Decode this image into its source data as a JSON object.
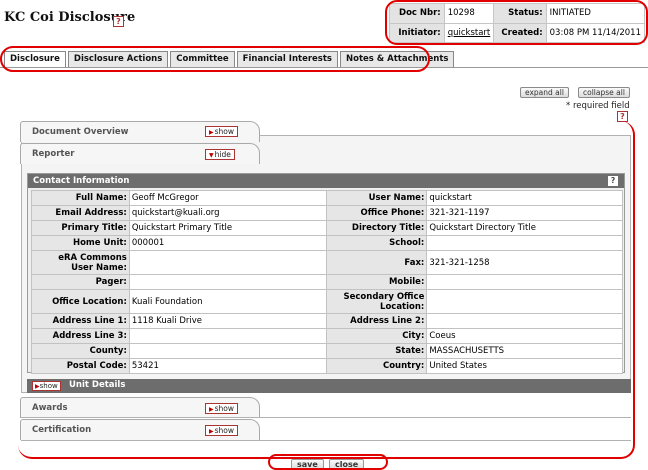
{
  "app": {
    "title": "KC Coi Disclosure",
    "help": "?"
  },
  "doc_header": {
    "doc_nbr_label": "Doc Nbr:",
    "doc_nbr": "10298",
    "status_label": "Status:",
    "status": "INITIATED",
    "initiator_label": "Initiator:",
    "initiator": "quickstart",
    "created_label": "Created:",
    "created": "03:08 PM 11/14/2011"
  },
  "tabs": [
    "Disclosure",
    "Disclosure Actions",
    "Committee",
    "Financial Interests",
    "Notes & Attachments"
  ],
  "toolbar": {
    "expand_all": "expand all",
    "collapse_all": "collapse all",
    "required_note": "* required field"
  },
  "sections": {
    "document_overview": {
      "label": "Document Overview",
      "button": "show"
    },
    "reporter": {
      "label": "Reporter",
      "button": "hide"
    },
    "awards": {
      "label": "Awards",
      "button": "show"
    },
    "certification": {
      "label": "Certification",
      "button": "show"
    }
  },
  "contact": {
    "title": "Contact Information",
    "help": "?",
    "rows": [
      [
        "Full Name:",
        "Geoff McGregor",
        "User Name:",
        "quickstart"
      ],
      [
        "Email Address:",
        "quickstart@kuali.org",
        "Office Phone:",
        "321-321-1197"
      ],
      [
        "Primary Title:",
        "Quickstart Primary Title",
        "Directory Title:",
        "Quickstart Directory Title"
      ],
      [
        "Home Unit:",
        "000001",
        "School:",
        ""
      ],
      [
        "eRA Commons User Name:",
        "",
        "Fax:",
        "321-321-1258"
      ],
      [
        "Pager:",
        "",
        "Mobile:",
        ""
      ],
      [
        "Office Location:",
        "Kuali Foundation",
        "Secondary Office Location:",
        ""
      ],
      [
        "Address Line 1:",
        "1118 Kuali Drive",
        "Address Line 2:",
        ""
      ],
      [
        "Address Line 3:",
        "",
        "City:",
        "Coeus"
      ],
      [
        "County:",
        "",
        "State:",
        "MASSACHUSETTS"
      ],
      [
        "Postal Code:",
        "53421",
        "Country:",
        "United States"
      ]
    ]
  },
  "unit_details": {
    "button": "show",
    "label": "Unit Details"
  },
  "footer": {
    "save": "save",
    "close": "close"
  }
}
